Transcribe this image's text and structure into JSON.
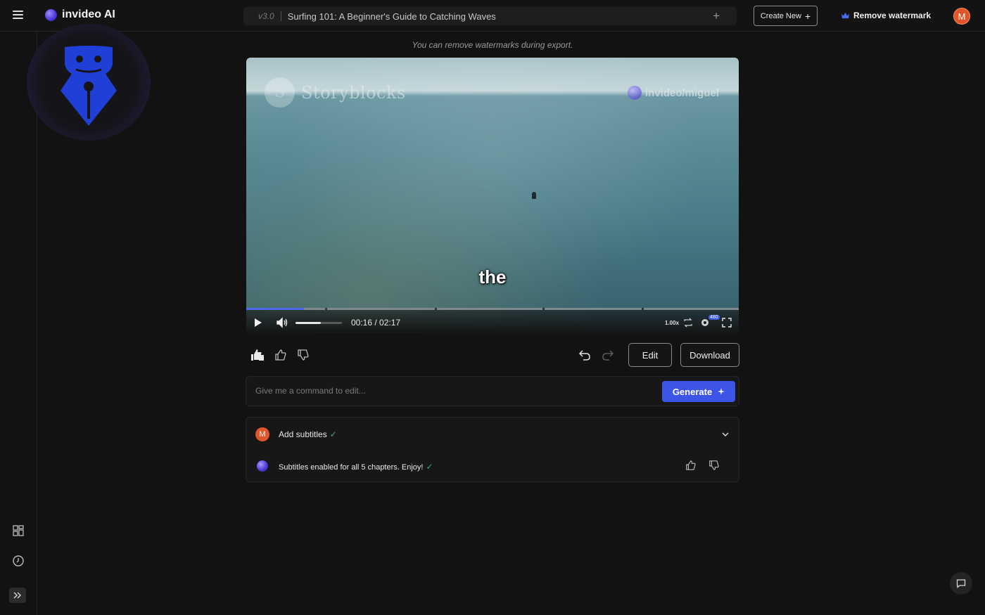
{
  "app": {
    "name": "invideo AI",
    "version": "v3.0",
    "project_title": "Surfing 101: A Beginner's Guide to Catching Waves",
    "create_new_label": "Create New",
    "remove_watermark_label": "Remove watermark",
    "user_initial": "M"
  },
  "notice": "You can remove watermarks during export.",
  "video": {
    "watermark_left": "Storyblocks",
    "watermark_left_initial": "S",
    "watermark_right": "invideo/miguel",
    "caption": "the",
    "time": "00:16 / 02:17",
    "progress": 0.117,
    "volume": 0.55,
    "speed": "1.00x",
    "quality_badge": "480"
  },
  "actions": {
    "edit_label": "Edit",
    "download_label": "Download"
  },
  "command": {
    "placeholder": "Give me a command to edit...",
    "generate_label": "Generate"
  },
  "chat": {
    "user_message": "Add subtitles",
    "ai_message": "Subtitles enabled for all 5 chapters. Enjoy!",
    "check": "✓"
  },
  "colors": {
    "accent": "#3d55e6",
    "avatar": "#e0562a",
    "success": "#3fa56a",
    "brand_icon": "#1f3fd6"
  },
  "icons": [
    "menu-icon",
    "logo-orb-icon",
    "plus-icon",
    "crown-icon",
    "pen-nib-icon",
    "grid-icon",
    "clock-icon",
    "double-chevron-right-icon",
    "play-icon",
    "volume-icon",
    "loop-icon",
    "settings-icon",
    "fullscreen-icon",
    "thumbs-up-multi-icon",
    "thumbs-up-icon",
    "thumbs-down-icon",
    "undo-icon",
    "redo-icon",
    "sparkle-icon",
    "chevron-down-icon",
    "chat-icon"
  ]
}
